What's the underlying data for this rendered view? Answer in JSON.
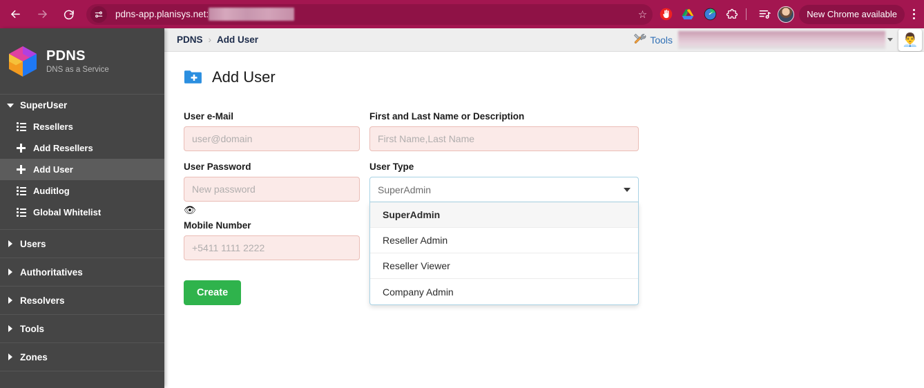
{
  "browser": {
    "back_icon": "back-arrow-icon",
    "forward_icon": "forward-arrow-icon",
    "reload_icon": "reload-icon",
    "site_info_icon": "site-settings-icon",
    "url": "pdns-app.planisys.net:",
    "bookmark_icon": "star-icon",
    "extensions": [
      {
        "name": "adblock-extension-icon",
        "glyph": "✋",
        "color": "#ee2222"
      },
      {
        "name": "google-drive-icon",
        "glyph": "△",
        "color": "#1a9e5a"
      },
      {
        "name": "speedtest-extension-icon",
        "glyph": "◔",
        "color": "#3b7dd8"
      },
      {
        "name": "puzzle-extensions-icon",
        "glyph": "⬚",
        "color": "#ffffff"
      },
      {
        "name": "reading-list-icon",
        "glyph": "♪",
        "color": "#ffffff"
      }
    ],
    "profile_icon": "profile-avatar-icon",
    "update_pill_label": "New Chrome available",
    "menu_icon": "three-dot-menu-icon"
  },
  "sidebar": {
    "brand": {
      "logo_icon": "pdns-cube-logo",
      "title": "PDNS",
      "subtitle": "DNS as a Service"
    },
    "groups": [
      {
        "label": "SuperUser",
        "expanded": true,
        "caret_icon": "caret-down-icon",
        "items": [
          {
            "label": "Resellers",
            "icon": "list-icon",
            "active": false
          },
          {
            "label": "Add Resellers",
            "icon": "plus-icon",
            "active": false
          },
          {
            "label": "Add User",
            "icon": "plus-icon",
            "active": true
          },
          {
            "label": "Auditlog",
            "icon": "list-icon",
            "active": false
          },
          {
            "label": "Global Whitelist",
            "icon": "list-icon",
            "active": false
          }
        ]
      },
      {
        "label": "Users",
        "expanded": false,
        "caret_icon": "caret-right-icon",
        "items": []
      },
      {
        "label": "Authoritatives",
        "expanded": false,
        "caret_icon": "caret-right-icon",
        "items": []
      },
      {
        "label": "Resolvers",
        "expanded": false,
        "caret_icon": "caret-right-icon",
        "items": []
      },
      {
        "label": "Tools",
        "expanded": false,
        "caret_icon": "caret-right-icon",
        "items": []
      },
      {
        "label": "Zones",
        "expanded": false,
        "caret_icon": "caret-right-icon",
        "items": []
      }
    ]
  },
  "topbar": {
    "breadcrumb": {
      "root": "PDNS",
      "separator": "›",
      "current": "Add User"
    },
    "tools": {
      "icon": "hammer-wrench-icon",
      "label": "Tools"
    },
    "account_selector_redacted": true,
    "avatar_icon": "office-worker-avatar-icon",
    "avatar_glyph": "👨‍💼"
  },
  "page": {
    "header_icon": "add-folder-icon",
    "title": "Add User",
    "fields": {
      "email": {
        "label": "User e-Mail",
        "value": "",
        "placeholder": "user@domain"
      },
      "password": {
        "label": "User Password",
        "value": "",
        "placeholder": "New password",
        "toggle_icon": "eye-icon",
        "toggle_glyph": "👁"
      },
      "mobile": {
        "label": "Mobile Number",
        "value": "",
        "placeholder": "+5411 1111 2222"
      },
      "fullname": {
        "label": "First and Last Name or Description",
        "value": "",
        "placeholder": "First Name,Last Name"
      },
      "usertype": {
        "label": "User Type",
        "value": "SuperAdmin",
        "caret_icon": "caret-down-icon"
      }
    },
    "usertype_options": [
      {
        "label": "SuperAdmin",
        "selected": true
      },
      {
        "label": "Reseller Admin",
        "selected": false
      },
      {
        "label": "Reseller Viewer",
        "selected": false
      },
      {
        "label": "Company Admin",
        "selected": false
      }
    ],
    "create_button": "Create"
  },
  "colors": {
    "browser_chrome": "#a31650",
    "sidebar": "#454545",
    "sidebar_active": "#5c5c5c",
    "primary_button": "#2fb34c",
    "input_invalid_bg": "#fbeae8",
    "input_invalid_border": "#eabdb6",
    "select_border": "#a8d2e4",
    "breadcrumb_text": "#1c2b4a",
    "link": "#2f6fb5"
  }
}
